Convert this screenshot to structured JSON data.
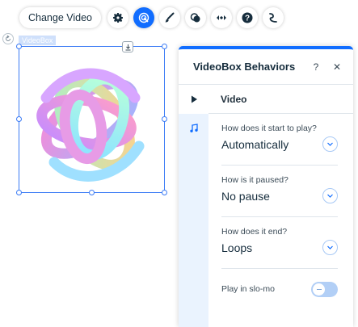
{
  "toolbar": {
    "change_video_label": "Change Video",
    "buttons": [
      "gear-icon",
      "animation-icon",
      "brush-icon",
      "layers-icon",
      "arrows-icon",
      "help-icon",
      "connect-icon"
    ]
  },
  "element": {
    "tag_label": "VideoBox"
  },
  "panel": {
    "title": "VideoBox Behaviors",
    "help_label": "?",
    "close_label": "✕",
    "video_section_label": "Video",
    "fields": [
      {
        "question": "How does it start to play?",
        "value": "Automatically"
      },
      {
        "question": "How is it paused?",
        "value": "No pause"
      },
      {
        "question": "How does it end?",
        "value": "Loops"
      }
    ],
    "slomo_label": "Play in slo-mo",
    "slomo_enabled": false
  },
  "colors": {
    "accent": "#116dff",
    "side_column": "#eaf3fe",
    "toggle_off": "#b2cff6"
  }
}
